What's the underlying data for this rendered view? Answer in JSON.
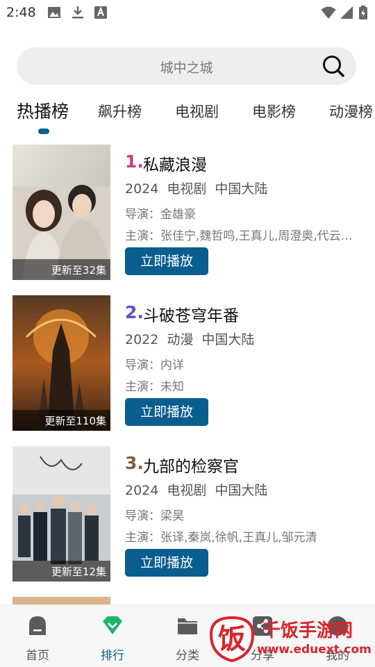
{
  "status_bar": {
    "time": "2:48"
  },
  "search": {
    "placeholder": "城中之城"
  },
  "tabs": [
    {
      "label": "热播榜",
      "active": true
    },
    {
      "label": "飙升榜"
    },
    {
      "label": "电视剧"
    },
    {
      "label": "电影榜"
    },
    {
      "label": "动漫榜"
    }
  ],
  "list": [
    {
      "rank": "1.",
      "rank_color": "#d23a7a",
      "title": "私藏浪漫",
      "year": "2024",
      "type": "电视剧",
      "region": "中国大陆",
      "director": "导演：金雄豪",
      "cast": "主演：张佳宁,魏哲鸣,王真儿,周澄奥,代云…",
      "update": "更新至32集",
      "play": "立即播放"
    },
    {
      "rank": "2.",
      "rank_color": "#5b4fd6",
      "title": "斗破苍穹年番",
      "year": "2022",
      "type": "动漫",
      "region": "中国大陆",
      "director": "导演：内详",
      "cast": "主演：未知",
      "update": "更新至110集",
      "play": "立即播放"
    },
    {
      "rank": "3.",
      "rank_color": "#8b5a34",
      "title": "九部的检察官",
      "year": "2024",
      "type": "电视剧",
      "region": "中国大陆",
      "director": "导演：梁昊",
      "cast": "主演：张译,秦岚,徐帆,王真儿,邹元清",
      "update": "更新至12集",
      "play": "立即播放"
    }
  ],
  "bottom_nav": [
    {
      "label": "首页",
      "icon": "home-icon"
    },
    {
      "label": "排行",
      "icon": "diamond-rank-icon",
      "active": true
    },
    {
      "label": "分类",
      "icon": "folder-icon"
    },
    {
      "label": "分享",
      "icon": "share-icon"
    },
    {
      "label": "我的",
      "icon": "profile-icon"
    }
  ],
  "watermark": {
    "logo_char": "饭",
    "name": "千饭手游网",
    "url": "www.eduext.com"
  },
  "colors": {
    "accent": "#0a5d8f",
    "watermark": "#d9242a"
  }
}
